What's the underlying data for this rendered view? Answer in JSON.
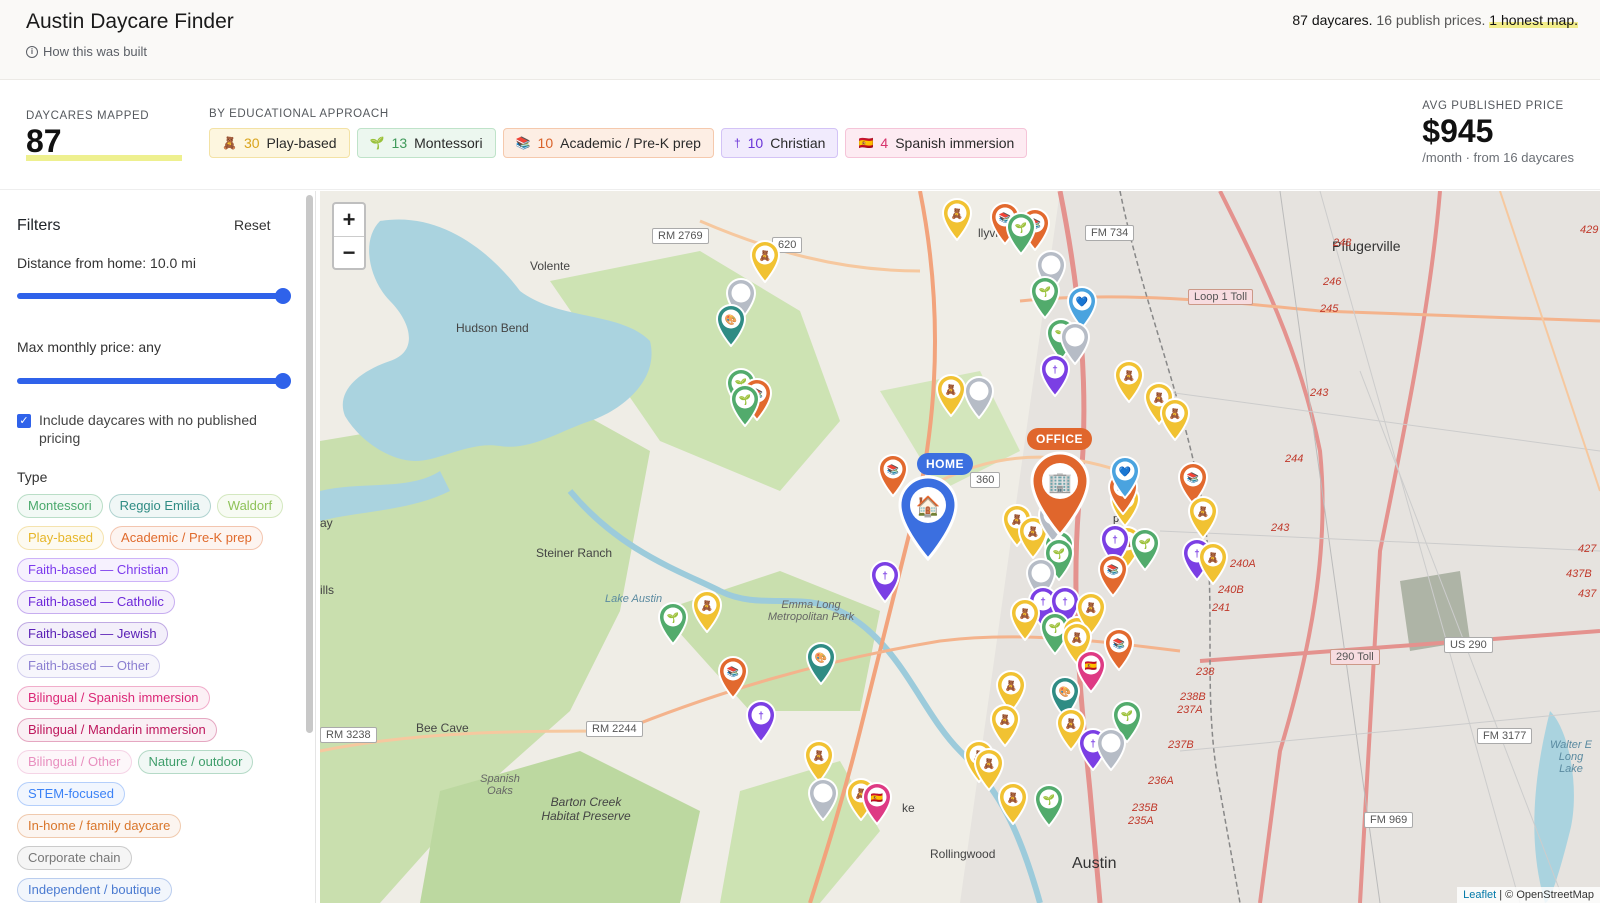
{
  "header": {
    "title": "Austin Daycare Finder",
    "how_built": "How this was built",
    "tagline_count": "87 daycares.",
    "tagline_prices": "16 publish prices.",
    "tagline_map": "1 honest map."
  },
  "stats": {
    "mapped_label": "Daycares mapped",
    "mapped_value": "87",
    "approach_label": "By educational approach",
    "approaches": [
      {
        "count": "30",
        "label": "Play-based",
        "icon": "teddy-bear-icon"
      },
      {
        "count": "13",
        "label": "Montessori",
        "icon": "sprout-icon"
      },
      {
        "count": "10",
        "label": "Academic / Pre-K prep",
        "icon": "books-icon"
      },
      {
        "count": "10",
        "label": "Christian",
        "icon": "cross-icon"
      },
      {
        "count": "4",
        "label": "Spanish immersion",
        "icon": "spain-flag-icon"
      }
    ],
    "avg_label": "Avg published price",
    "avg_value": "$945",
    "avg_sub": "/month · from 16 daycares"
  },
  "filters": {
    "title": "Filters",
    "reset": "Reset",
    "distance_label": "Distance from home: 10.0 mi",
    "distance_fraction": 1.0,
    "price_label": "Max monthly price: any",
    "price_fraction": 1.0,
    "include_unpriced_label": "Include daycares with no published pricing",
    "include_unpriced_checked": true,
    "type_title": "Type",
    "types": [
      {
        "label": "Montessori",
        "color": "#4aa96c"
      },
      {
        "label": "Reggio Emilia",
        "color": "#2f8c84"
      },
      {
        "label": "Waldorf",
        "color": "#8fc25a"
      },
      {
        "label": "Play-based",
        "color": "#e6b62a"
      },
      {
        "label": "Academic / Pre-K prep",
        "color": "#e06a2c"
      },
      {
        "label": "Faith-based — Christian",
        "color": "#7c3aed"
      },
      {
        "label": "Faith-based — Catholic",
        "color": "#6d28d9"
      },
      {
        "label": "Faith-based — Jewish",
        "color": "#5b21b6"
      },
      {
        "label": "Faith-based — Other",
        "color": "#8b7fd1"
      },
      {
        "label": "Bilingual / Spanish immersion",
        "color": "#db2777"
      },
      {
        "label": "Bilingual / Mandarin immersion",
        "color": "#be185d"
      },
      {
        "label": "Bilingual / Other",
        "color": "#e88fbf"
      },
      {
        "label": "Nature / outdoor",
        "color": "#3f9e6b"
      },
      {
        "label": "STEM-focused",
        "color": "#3b82f6"
      },
      {
        "label": "In-home / family daycare",
        "color": "#d9762b"
      },
      {
        "label": "Corporate chain",
        "color": "#777777"
      },
      {
        "label": "Independent / boutique",
        "color": "#4b7bd1"
      }
    ]
  },
  "map": {
    "zoom_in": "+",
    "zoom_out": "−",
    "attribution_leaflet": "Leaflet",
    "attribution_osm": "| © OpenStreetMap",
    "home_label": "HOME",
    "office_label": "OFFICE",
    "places": [
      "Pflugerville",
      "Volente",
      "Hudson Bend",
      "Steiner Ranch",
      "Lake Austin",
      "Emma Long Metropolitan Park",
      "Bee Cave",
      "Spanish Oaks",
      "Barton Creek Habitat Preserve",
      "Rollingwood",
      "Austin",
      "Walter E Long Lake",
      "ay",
      "ills",
      "ke",
      "llyville"
    ],
    "roads": [
      "RM 2769",
      "620",
      "FM 734",
      "Loop 1 Toll",
      "360",
      "RM 2244",
      "RM 3238",
      "290 Toll",
      "US 290",
      "FM 3177",
      "FM 969"
    ],
    "exits": [
      "248",
      "246",
      "245",
      "243",
      "244",
      "243",
      "240A",
      "240B",
      "241",
      "238",
      "238B",
      "237A",
      "237B",
      "236A",
      "235B",
      "235A",
      "429",
      "427",
      "437B",
      "437",
      "p"
    ],
    "colors": {
      "play": "#f1c232",
      "montessori": "#52ab6c",
      "academic": "#e2692e",
      "christian": "#7b3fe4",
      "spanish": "#de3a84",
      "reggio": "#2f8c84",
      "unknown": "#b6bcc6",
      "stem": "#4aa3df",
      "home": "#3b6fe0",
      "office": "#e0662c"
    }
  }
}
